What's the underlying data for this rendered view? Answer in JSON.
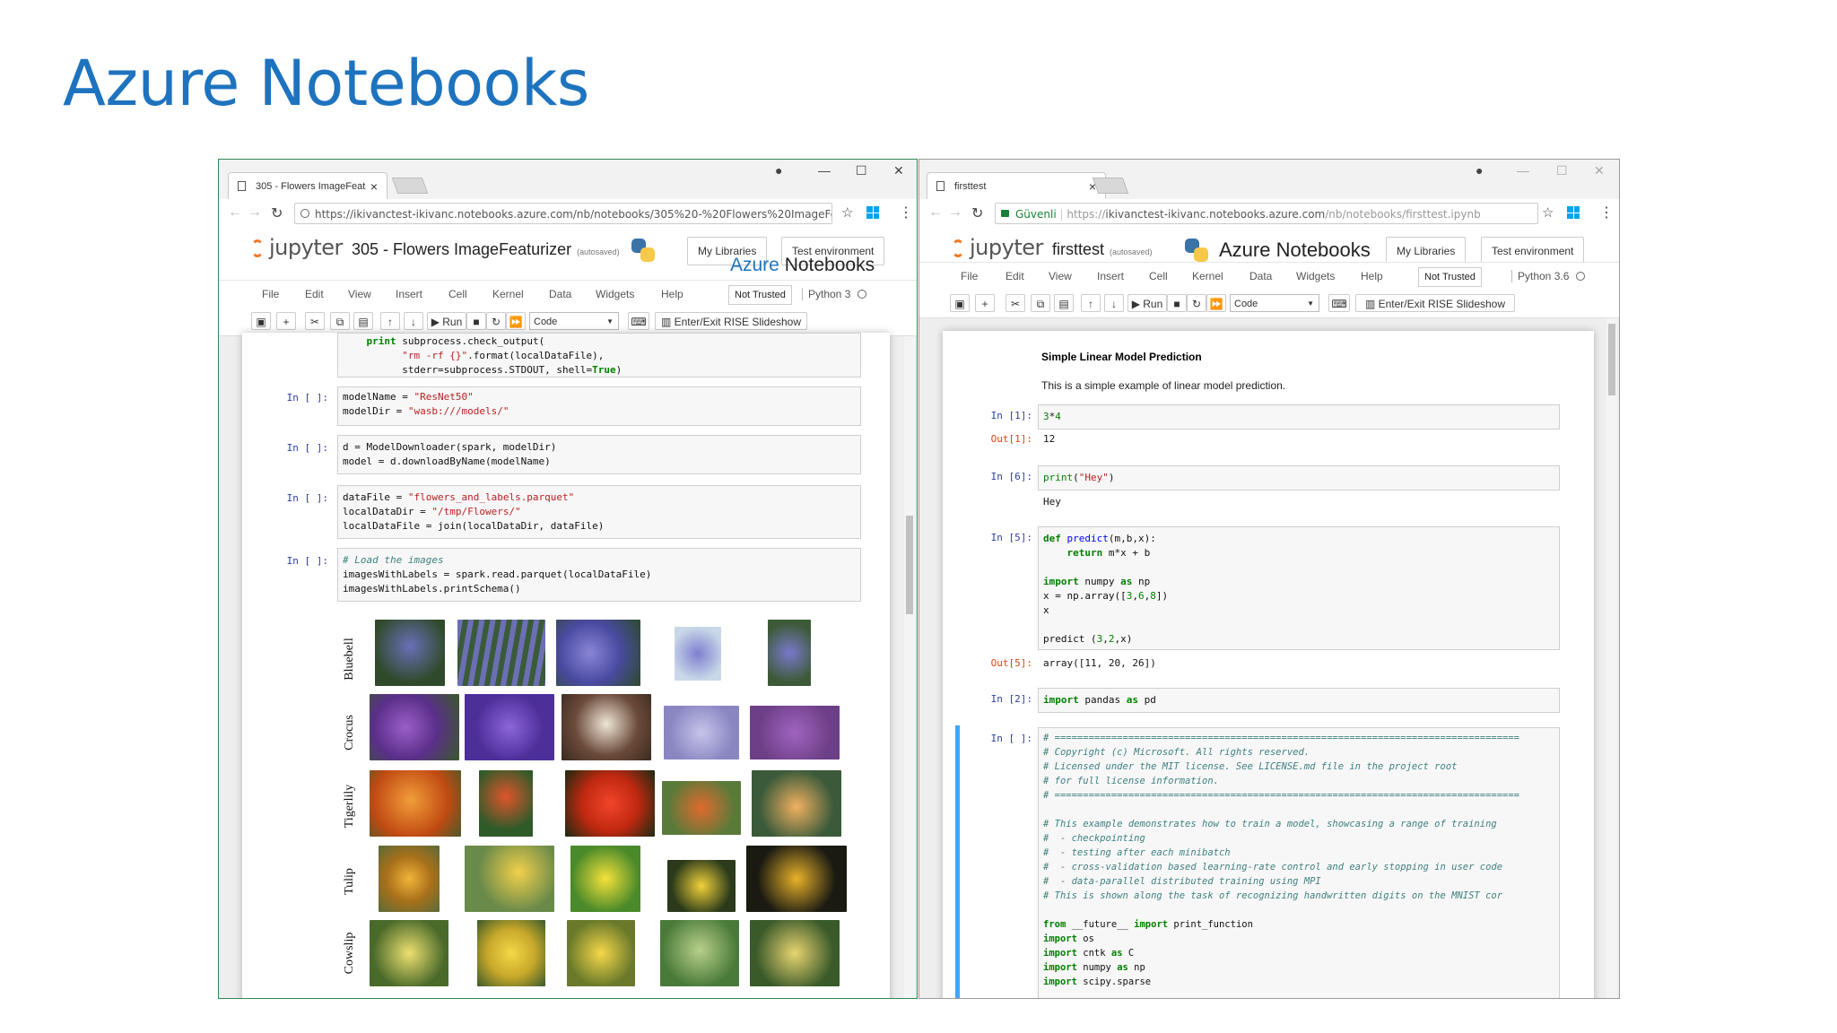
{
  "slide": {
    "title": "Azure Notebooks"
  },
  "left": {
    "tab_title": "305 - Flowers ImageFeat",
    "url": "https://ikivanctest-ikivanc.notebooks.azure.com/nb/notebooks/305%20-%20Flowers%20ImageFea...",
    "jupyter": "jupyter",
    "notebook_name": "305 - Flowers ImageFeaturizer",
    "autosaved": "(autosaved)",
    "brand_azure": "Azure",
    "brand_notebooks": "Notebooks",
    "btn_my_libraries": "My Libraries",
    "btn_test_env": "Test environment",
    "menu": [
      "File",
      "Edit",
      "View",
      "Insert",
      "Cell",
      "Kernel",
      "Data",
      "Widgets",
      "Help"
    ],
    "not_trusted": "Not Trusted",
    "kernel": "Python 3",
    "run": "Run",
    "cell_type": "Code",
    "rise": "Enter/Exit RISE Slideshow",
    "prompt": "In [ ]:",
    "flower_labels": [
      "Bluebell",
      "Crocus",
      "Tigerlily",
      "Tulip",
      "Cowslip"
    ]
  },
  "right": {
    "tab_title": "firsttest",
    "url_secure": "Güvenli",
    "url_prefix": "https://",
    "url_host": "ikivanctest-ikivanc.notebooks.azure.com",
    "url_path": "/nb/notebooks/firsttest.ipynb",
    "jupyter": "jupyter",
    "notebook_name": "firsttest",
    "autosaved": "(autosaved)",
    "brand": "Azure Notebooks",
    "btn_my_libraries": "My Libraries",
    "btn_test_env": "Test environment",
    "menu": [
      "File",
      "Edit",
      "View",
      "Insert",
      "Cell",
      "Kernel",
      "Data",
      "Widgets",
      "Help"
    ],
    "not_trusted": "Not Trusted",
    "kernel": "Python 3.6",
    "run": "Run",
    "cell_type": "Code",
    "rise": "Enter/Exit RISE Slideshow",
    "md_heading": "Simple Linear Model Prediction",
    "md_text": "This is a simple example of linear model prediction.",
    "cells": [
      {
        "prompt": "In [1]:",
        "out_prompt": "Out[1]:",
        "output": "12"
      },
      {
        "prompt": "In [6]:",
        "output": "Hey"
      },
      {
        "prompt": "In [5]:",
        "out_prompt": "Out[5]:",
        "output": "array([11, 20, 26])"
      },
      {
        "prompt": "In [2]:"
      },
      {
        "prompt": "In [ ]:"
      }
    ]
  },
  "colors": {
    "title_blue": "#1e73be",
    "prompt_in": "#303f9f",
    "prompt_out": "#d84315",
    "selected_cell": "#42a5f5"
  }
}
